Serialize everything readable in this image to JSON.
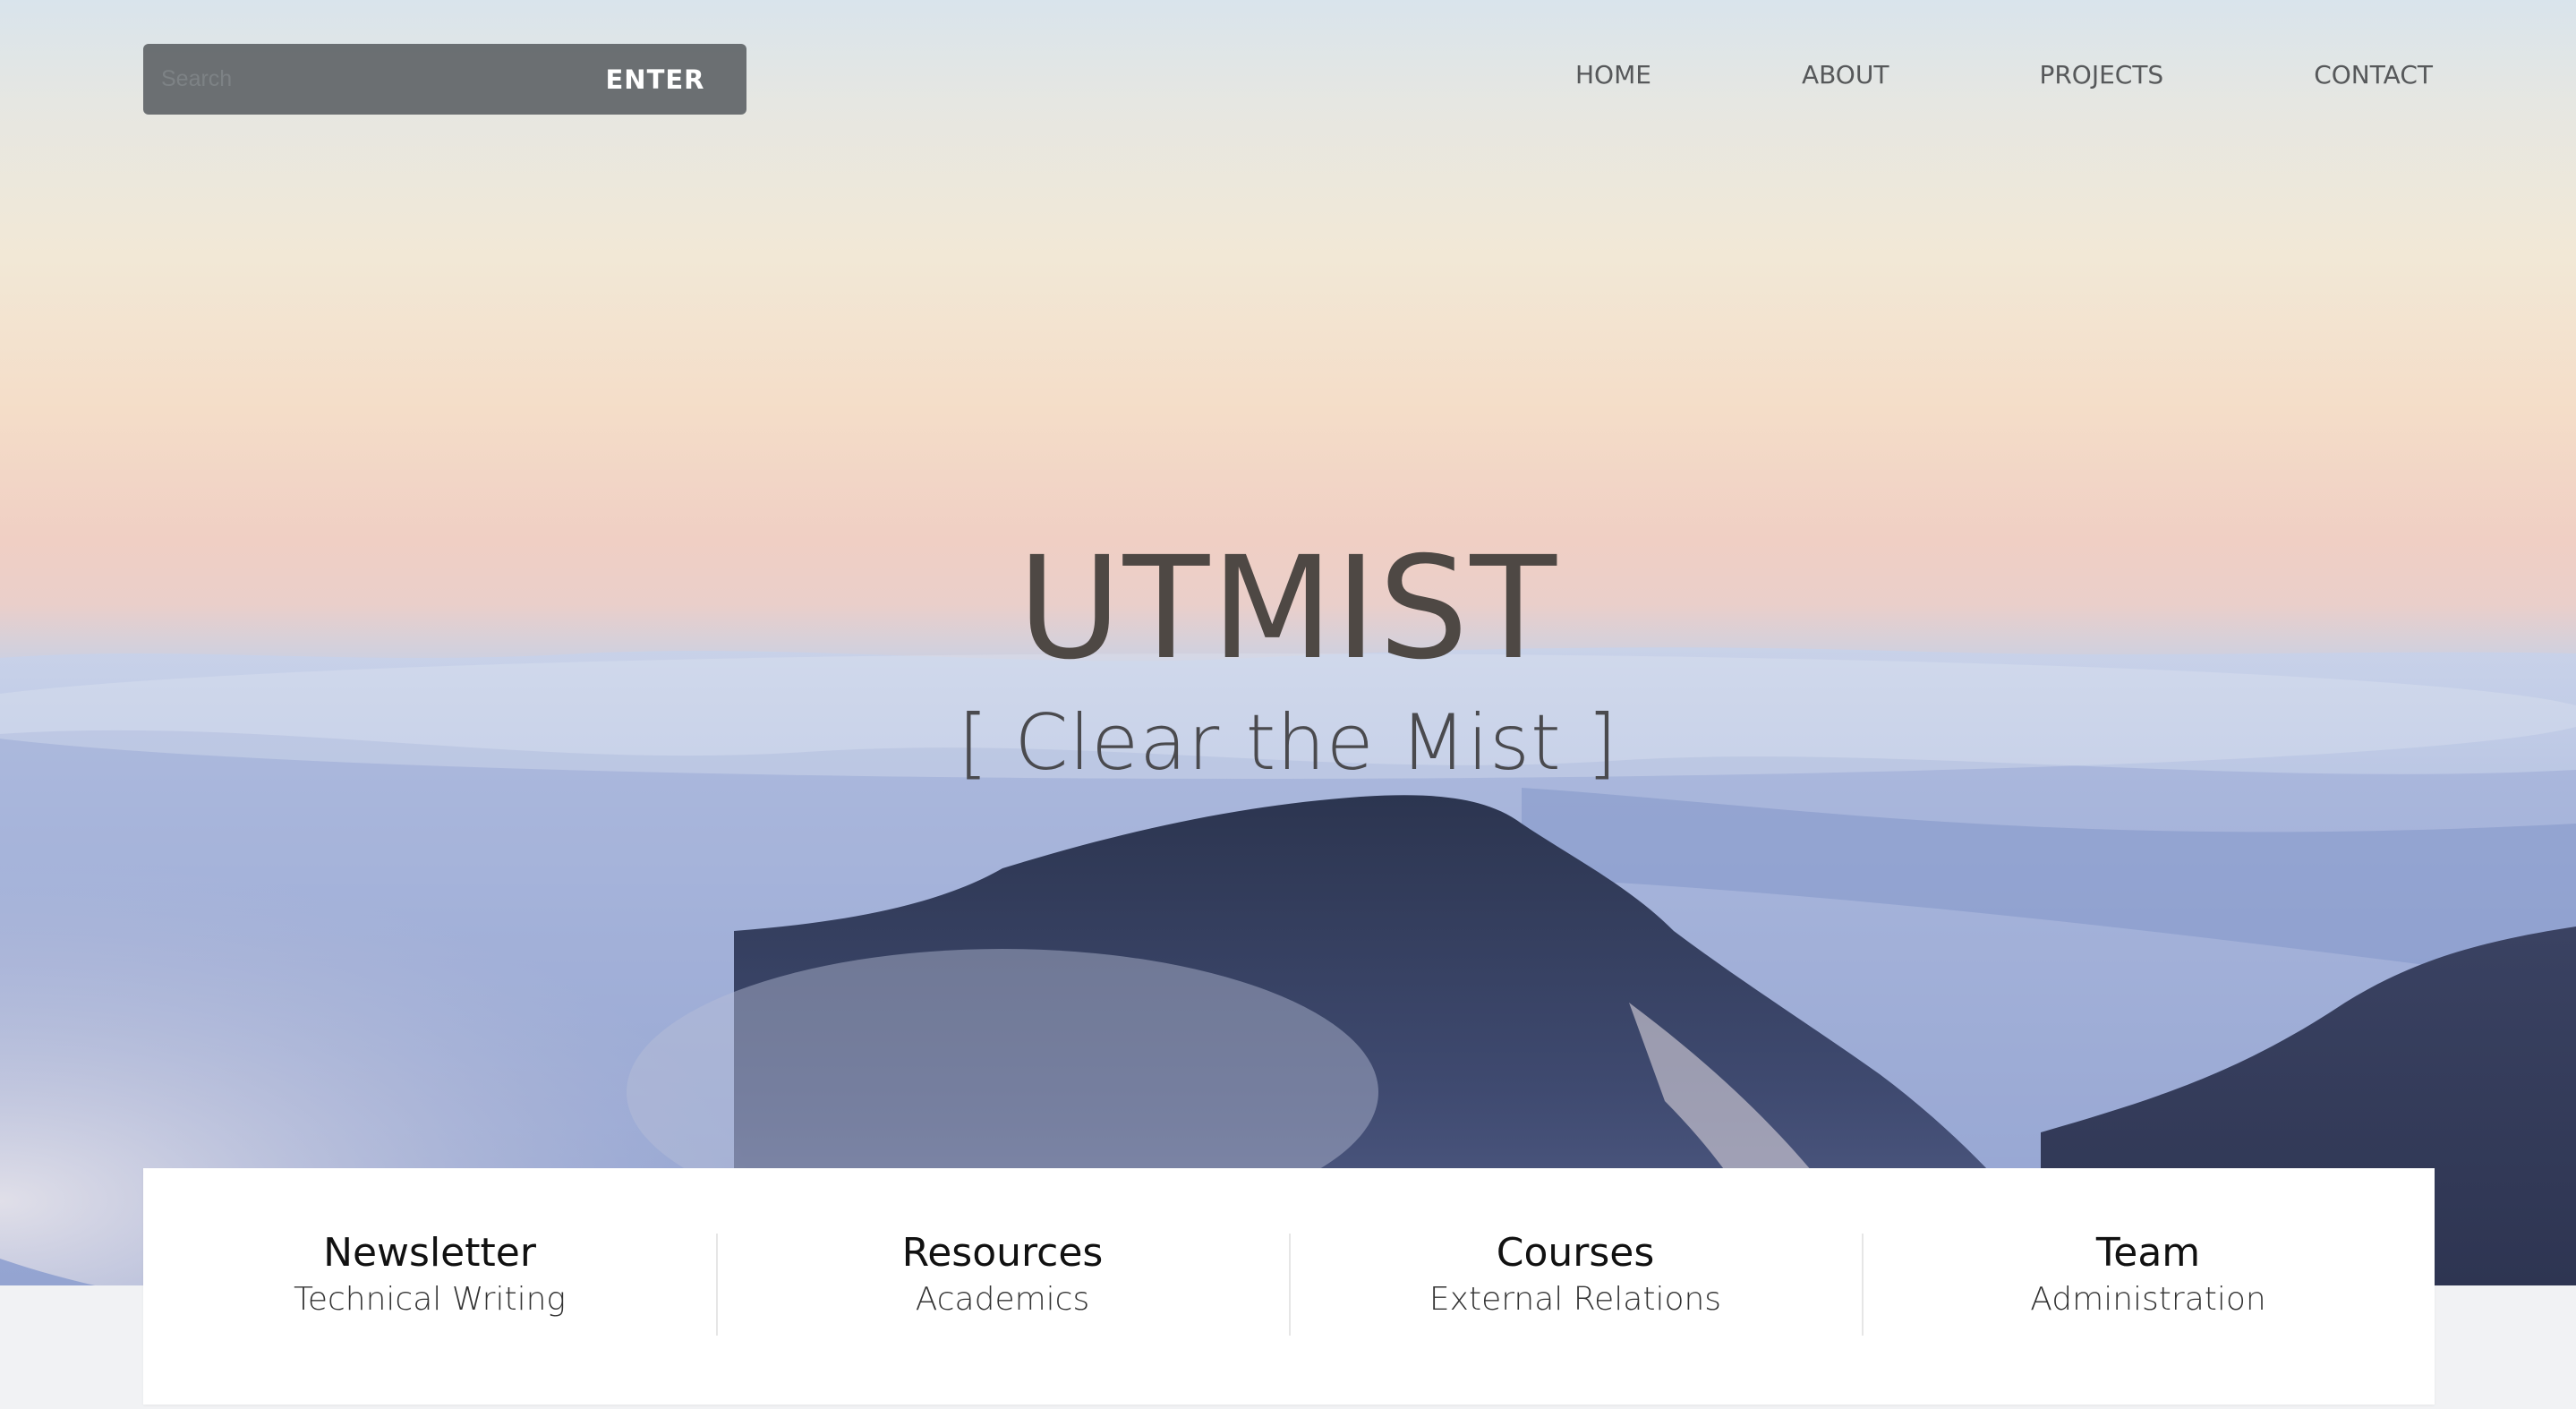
{
  "search": {
    "placeholder": "Search",
    "button_label": "ENTER"
  },
  "nav": {
    "items": [
      {
        "label": "HOME"
      },
      {
        "label": "ABOUT"
      },
      {
        "label": "PROJECTS"
      },
      {
        "label": "CONTACT"
      }
    ]
  },
  "hero": {
    "title": "UTMIST",
    "tagline": "[ Clear the Mist ]"
  },
  "cards": [
    {
      "title": "Newsletter",
      "subtitle": "Technical Writing"
    },
    {
      "title": "Resources",
      "subtitle": "Academics"
    },
    {
      "title": "Courses",
      "subtitle": "External Relations"
    },
    {
      "title": "Team",
      "subtitle": "Administration"
    }
  ],
  "colors": {
    "search_bg": "#5a5f62",
    "nav_text": "#56585a",
    "title_text": "#4e4844",
    "card_bg": "#ffffff",
    "page_bg": "#f1f2f4"
  }
}
